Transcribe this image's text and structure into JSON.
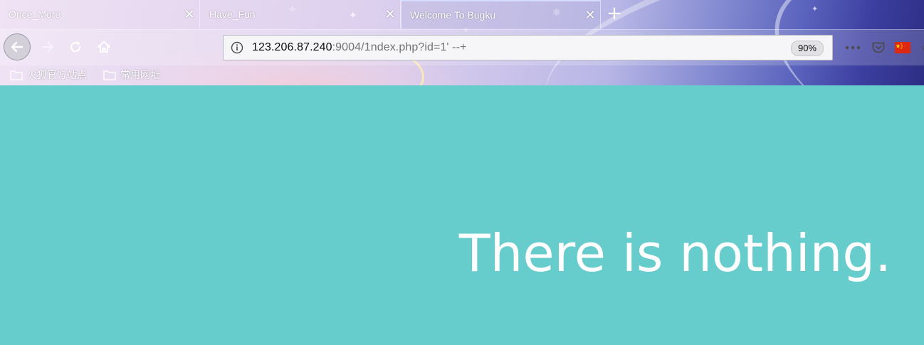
{
  "tabs": [
    {
      "title": "Once_More",
      "active": false
    },
    {
      "title": "Have_Fun",
      "active": false
    },
    {
      "title": "Welcome To Bugku",
      "active": true
    }
  ],
  "tab_close_glyph": "✕",
  "new_tab_glyph": "+",
  "address_bar": {
    "host": "123.206.87.240",
    "rest": ":9004/1ndex.php?id=1' --+",
    "zoom": "90%"
  },
  "bookmarks": [
    {
      "label": "火狐官方站点",
      "icon": "folder-icon"
    },
    {
      "label": "常用网址",
      "icon": "folder-icon"
    }
  ],
  "page": {
    "headline": "There is nothing.",
    "background_color": "#67cccc",
    "text_color": "#ffffff"
  }
}
